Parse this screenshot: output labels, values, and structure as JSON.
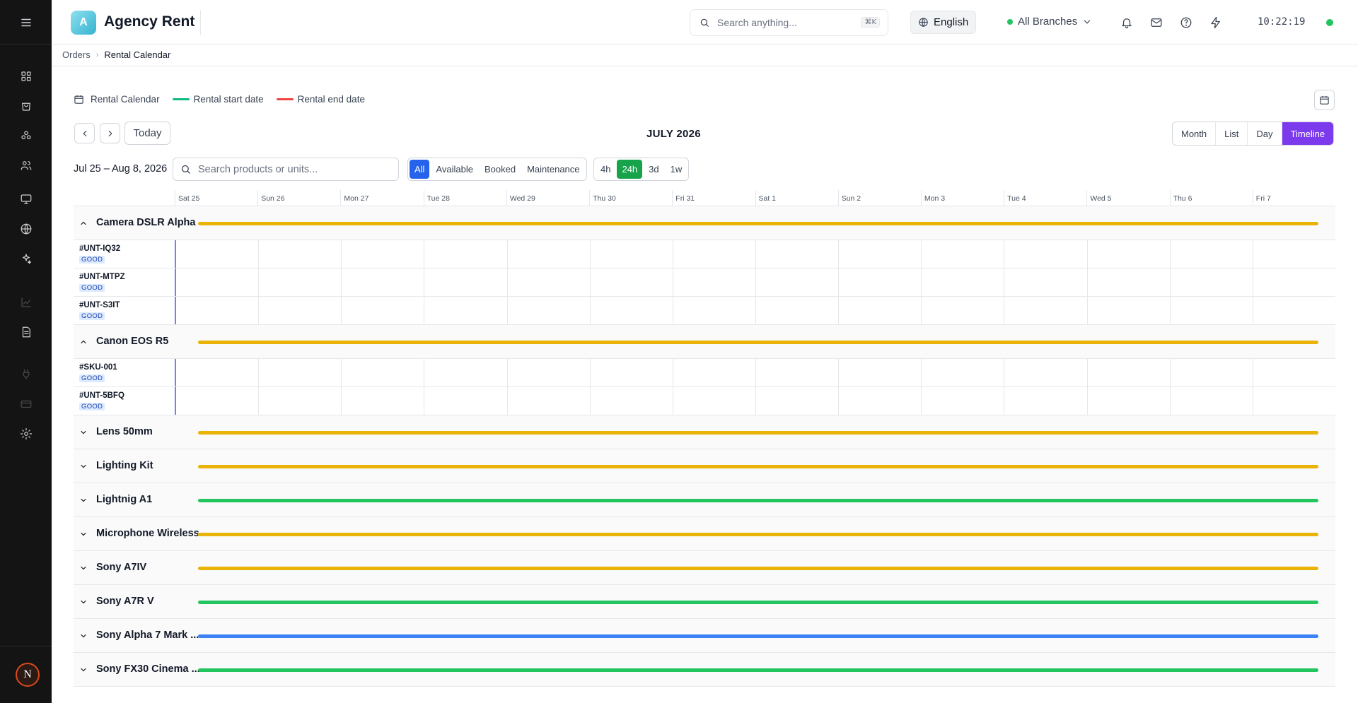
{
  "app": {
    "logo_letter": "A",
    "title": "Agency Rent"
  },
  "topbar": {
    "search_placeholder": "Search anything...",
    "search_shortcut": "⌘K",
    "language": "English",
    "branch": "All Branches",
    "clock": "10:22:19"
  },
  "user": {
    "avatar_letter": "N"
  },
  "breadcrumb": {
    "parent": "Orders",
    "current": "Rental Calendar"
  },
  "legend": {
    "calendar_label": "Rental Calendar",
    "start_label": "Rental start date",
    "end_label": "Rental end date",
    "start_color": "#10b981",
    "end_color": "#ef4444"
  },
  "nav": {
    "today": "Today",
    "month_title": "JULY 2026"
  },
  "views": [
    "Month",
    "List",
    "Day",
    "Timeline"
  ],
  "active_view": "Timeline",
  "filters": {
    "range": "Jul 25 – Aug 8, 2026",
    "search_placeholder": "Search products or units...",
    "status": [
      "All",
      "Available",
      "Booked",
      "Maintenance"
    ],
    "active_status": "All",
    "zoom": [
      "4h",
      "24h",
      "3d",
      "1w"
    ],
    "active_zoom": "24h"
  },
  "days": [
    "Sat 25",
    "Sun 26",
    "Mon 27",
    "Tue 28",
    "Wed 29",
    "Thu 30",
    "Fri 31",
    "Sat 1",
    "Sun 2",
    "Mon 3",
    "Tue 4",
    "Wed 5",
    "Thu 6",
    "Fri 7"
  ],
  "groups": [
    {
      "name": "Camera DSLR Alpha",
      "expanded": true,
      "bar_color": "#eab308",
      "units": [
        {
          "id": "#UNT-IQ32",
          "condition": "GOOD"
        },
        {
          "id": "#UNT-MTPZ",
          "condition": "GOOD"
        },
        {
          "id": "#UNT-S3IT",
          "condition": "GOOD"
        }
      ]
    },
    {
      "name": "Canon EOS R5",
      "expanded": true,
      "bar_color": "#eab308",
      "units": [
        {
          "id": "#SKU-001",
          "condition": "GOOD"
        },
        {
          "id": "#UNT-5BFQ",
          "condition": "GOOD"
        }
      ]
    },
    {
      "name": "Lens 50mm",
      "expanded": false,
      "bar_color": "#eab308",
      "units": []
    },
    {
      "name": "Lighting Kit",
      "expanded": false,
      "bar_color": "#eab308",
      "units": []
    },
    {
      "name": "Lightnig A1",
      "expanded": false,
      "bar_color": "#22c55e",
      "units": []
    },
    {
      "name": "Microphone Wireless",
      "expanded": false,
      "bar_color": "#eab308",
      "units": []
    },
    {
      "name": "Sony A7IV",
      "expanded": false,
      "bar_color": "#eab308",
      "units": []
    },
    {
      "name": "Sony A7R V",
      "expanded": false,
      "bar_color": "#22c55e",
      "units": []
    },
    {
      "name": "Sony Alpha 7 Mark ...",
      "expanded": false,
      "bar_color": "#3b82f6",
      "units": []
    },
    {
      "name": "Sony FX30 Cinema ...",
      "expanded": false,
      "bar_color": "#22c55e",
      "units": []
    }
  ]
}
